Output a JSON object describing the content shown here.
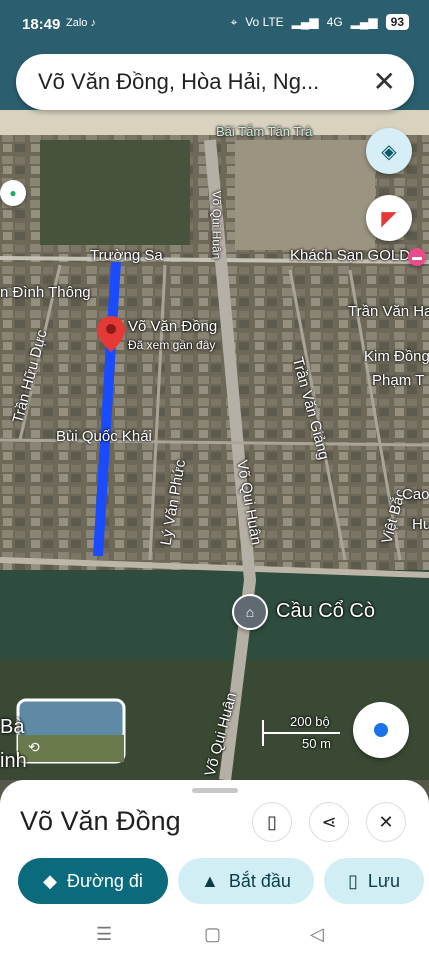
{
  "status": {
    "time": "18:49",
    "left_icons": "Zalo ♪",
    "network": "Vo LTE",
    "net2": "4G",
    "battery": "93"
  },
  "search": {
    "query": "Võ Văn Đồng, Hòa Hải, Ng..."
  },
  "map_labels": {
    "beach": "Bãi Tắm Tân Trà",
    "truong_sa": "Trường Sa",
    "hotel": "Khách Sạn GOLD",
    "dinh_thong": "n Đình Thông",
    "tran_van_ha": "Trần Văn Ha",
    "vo_van_dong": "Võ Văn Đồng",
    "recent": "Đã xem gần đây",
    "kim_dong": "Kim Đồng",
    "pham_t": "Phạm T",
    "tran_huu_duc": "Trần Hữu Dực",
    "bui_quoc_khai": "Bùi Quốc Khái",
    "tran_van_giang": "Trần Văn Giảng",
    "vo_qui_huan_top": "Võ Qui Huân",
    "vo_qui_huan_mid": "Võ Qui Huân",
    "vo_qui_huan_bot": "Võ Qui Huân",
    "ly_van_phuc": "Lý Văn Phức",
    "viet_bac": "Việt Bắc",
    "cao": "Cao",
    "hu": "Hu",
    "cau_co_co": "Cầu Cổ Cò",
    "ba": "Bà",
    "inh": "inh"
  },
  "scale": {
    "feet": "200 bộ",
    "meters": "50 m"
  },
  "place": {
    "title": "Võ Văn Đồng"
  },
  "actions": {
    "directions": "Đường đi",
    "start": "Bắt đầu",
    "save": "Lưu"
  },
  "colors": {
    "primary": "#0b6b7d",
    "chip": "#d2eef5",
    "route": "#1a4bff",
    "pin": "#e53935"
  }
}
